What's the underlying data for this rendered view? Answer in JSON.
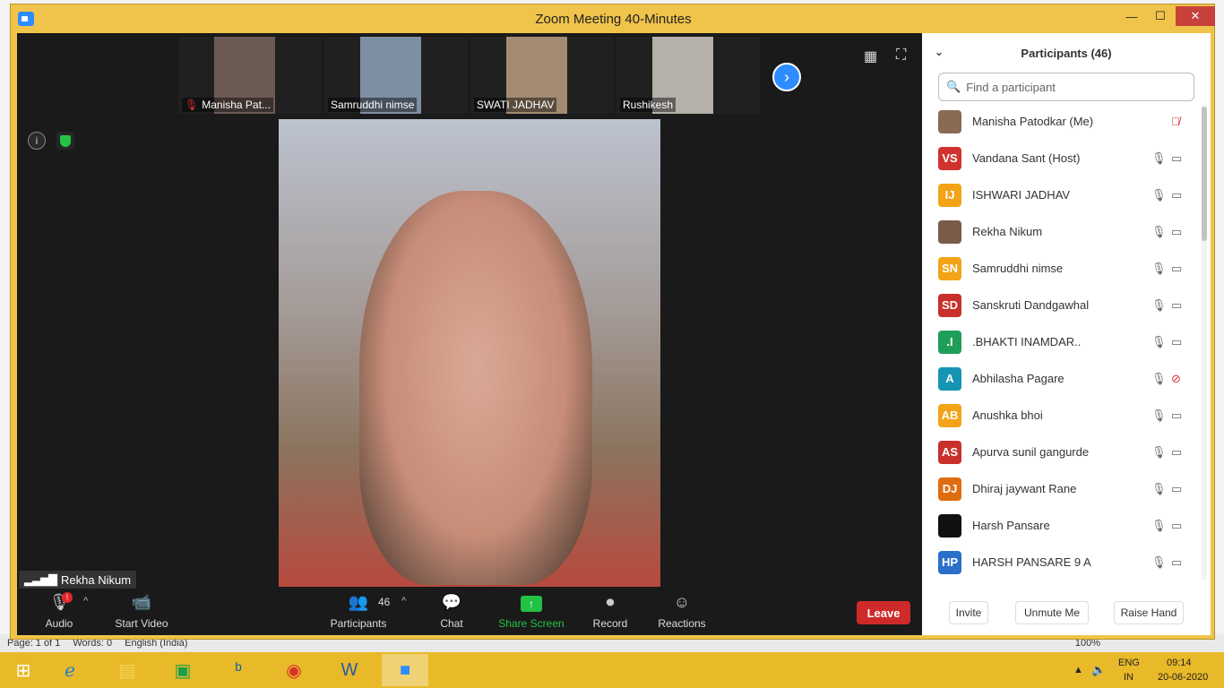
{
  "window": {
    "title": "Zoom Meeting 40-Minutes",
    "min": "—",
    "max": "☐",
    "close": "✕"
  },
  "background_app": {
    "status": [
      "Page: 1 of 1",
      "Words: 0",
      "English (India)"
    ],
    "zoom": "100%"
  },
  "thumbnails": [
    {
      "name": "Manisha Pat...",
      "muted": true
    },
    {
      "name": "Samruddhi nimse",
      "muted": false
    },
    {
      "name": "SWATI JADHAV",
      "muted": false
    },
    {
      "name": "Rushikesh",
      "muted": false
    }
  ],
  "icons": {
    "next": "›",
    "grid": "▦",
    "fullscreen": "⛶",
    "info": "i",
    "search": "🔍",
    "collapse": "⌄",
    "caret": "^"
  },
  "speaker": {
    "name": "Rekha Nikum",
    "bars": "▂▃▅▇"
  },
  "toolbar": {
    "audio": "Audio",
    "audio_badge": "!",
    "start_video": "Start Video",
    "participants": "Participants",
    "participant_count": "46",
    "chat": "Chat",
    "share_screen": "Share Screen",
    "record": "Record",
    "reactions": "Reactions",
    "leave": "Leave",
    "icons": {
      "mic": "🎙",
      "video": "📹",
      "people": "👥",
      "chat": "💬",
      "share": "↑",
      "record": "⏺",
      "reactions": "☺"
    }
  },
  "panel": {
    "title": "Participants (46)",
    "search_placeholder": "Find a participant",
    "participants": [
      {
        "name": "Manisha Patodkar (Me)",
        "initials": "",
        "color": "#8a6a55",
        "mic_muted": true,
        "cam_off": false,
        "cam_hidden": true
      },
      {
        "name": "Vandana Sant (Host)",
        "initials": "VS",
        "color": "#d0332f",
        "mic_muted": false,
        "cam_off": false
      },
      {
        "name": "ISHWARI JADHAV",
        "initials": "IJ",
        "color": "#f2a318",
        "mic_muted": false,
        "cam_off": false
      },
      {
        "name": "Rekha Nikum",
        "initials": "",
        "color": "#7a5a48",
        "mic_muted": false,
        "cam_off": false
      },
      {
        "name": "Samruddhi nimse",
        "initials": "SN",
        "color": "#f2a318",
        "mic_muted": false,
        "cam_off": false
      },
      {
        "name": "Sanskruti Dandgawhal",
        "initials": "SD",
        "color": "#c9302c",
        "mic_muted": false,
        "cam_off": false
      },
      {
        "name": ".BHAKTI INAMDAR..",
        "initials": ".I",
        "color": "#1f9e5a",
        "mic_muted": false,
        "cam_off": false
      },
      {
        "name": "Abhilasha Pagare",
        "initials": "A",
        "color": "#1595b3",
        "mic_muted": false,
        "cam_off": true
      },
      {
        "name": "Anushka bhoi",
        "initials": "AB",
        "color": "#f2a318",
        "mic_muted": false,
        "cam_off": false
      },
      {
        "name": "Apurva sunil gangurde",
        "initials": "AS",
        "color": "#c9302c",
        "mic_muted": false,
        "cam_off": false
      },
      {
        "name": "Dhiraj jaywant Rane",
        "initials": "DJ",
        "color": "#e06c10",
        "mic_muted": false,
        "cam_off": false
      },
      {
        "name": "Harsh Pansare",
        "initials": "",
        "color": "#111111",
        "mic_muted": false,
        "cam_off": false
      },
      {
        "name": "HARSH PANSARE       9 A",
        "initials": "HP",
        "color": "#2a6fc9",
        "mic_muted": false,
        "cam_off": false
      }
    ],
    "invite": "Invite",
    "unmute": "Unmute Me",
    "raise_hand": "Raise Hand"
  },
  "taskbar": {
    "apps": [
      "start",
      "internet-explorer",
      "file-explorer",
      "store",
      "bing",
      "chrome",
      "word",
      "zoom"
    ],
    "tray": {
      "lang": "ENG",
      "region": "IN",
      "time": "09:14",
      "date": "20-06-2020"
    }
  }
}
